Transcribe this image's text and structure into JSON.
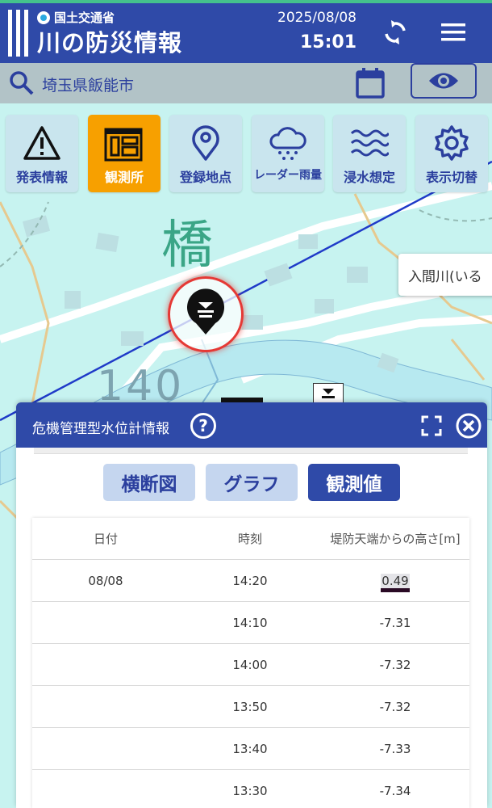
{
  "header": {
    "ministry": "国土交通省",
    "app_name": "川の防災情報",
    "date": "2025/08/08",
    "time": "15:01"
  },
  "search": {
    "location": "埼玉県飯能市"
  },
  "toolbar": [
    {
      "label": "発表情報",
      "icon": "warning-icon"
    },
    {
      "label": "観測所",
      "icon": "station-icon",
      "active": true
    },
    {
      "label": "登録地点",
      "icon": "location-pin-icon"
    },
    {
      "label": "レーダー雨量",
      "icon": "rain-cloud-icon"
    },
    {
      "label": "浸水想定",
      "icon": "waves-icon"
    },
    {
      "label": "表示切替",
      "icon": "gear-icon"
    }
  ],
  "map": {
    "label_kanji": "橋",
    "label_number": "140",
    "river_tooltip": "入間川(いる"
  },
  "panel": {
    "title": "危機管理型水位計情報",
    "tabs": [
      {
        "label": "横断図",
        "active": false
      },
      {
        "label": "グラフ",
        "active": false
      },
      {
        "label": "観測値",
        "active": true
      }
    ],
    "table": {
      "headers": [
        "日付",
        "時刻",
        "堤防天端からの高さ[m]"
      ],
      "rows": [
        {
          "date": "08/08",
          "time": "14:20",
          "value": "0.49"
        },
        {
          "date": "",
          "time": "14:10",
          "value": "-7.31"
        },
        {
          "date": "",
          "time": "14:00",
          "value": "-7.32"
        },
        {
          "date": "",
          "time": "13:50",
          "value": "-7.32"
        },
        {
          "date": "",
          "time": "13:40",
          "value": "-7.33"
        },
        {
          "date": "",
          "time": "13:30",
          "value": "-7.34"
        }
      ]
    }
  },
  "colors": {
    "header_blue": "#2f4aa8",
    "accent_orange": "#f7a000",
    "map_water": "#c7f3f0",
    "marker_red": "#e53935"
  }
}
